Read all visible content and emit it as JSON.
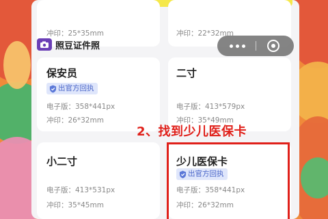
{
  "brand": {
    "name": "照豆证件照",
    "icon": "camera-icon"
  },
  "annotation": "2、找到少儿医保卡",
  "cards": {
    "top_left": {
      "line2": "冲印：25*35mm"
    },
    "top_right": {
      "line2": "冲印：22*32mm"
    },
    "security": {
      "title": "保安员",
      "badge": "出官方回执",
      "line1": "电子版：358*441px",
      "line2": "冲印：26*32mm"
    },
    "two_inch": {
      "title": "二寸",
      "line1": "电子版：413*579px",
      "line2": "冲印：35*49mm"
    },
    "small_two_inch": {
      "title": "小二寸",
      "line1": "电子版：413*531px",
      "line2": "冲印：35*45mm"
    },
    "child_medical": {
      "title": "少儿医保卡",
      "badge": "出官方回执",
      "line1": "电子版：358*441px",
      "line2": "冲印：26*32mm"
    }
  },
  "colors": {
    "accent": "#e0201a",
    "badge_bg": "#dfe6fb",
    "badge_text": "#4965c8"
  }
}
